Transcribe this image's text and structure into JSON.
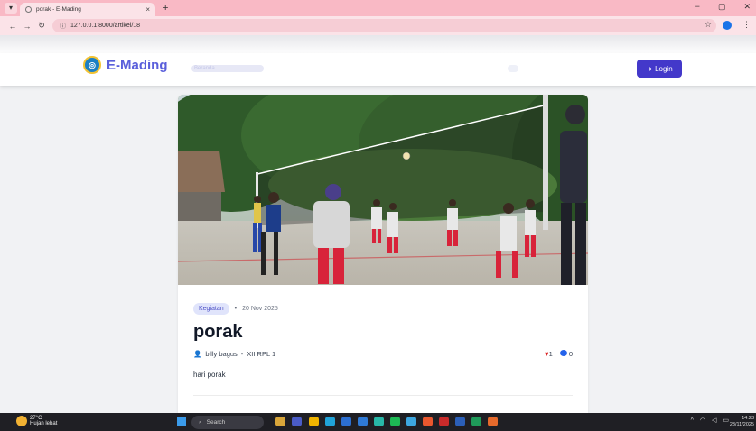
{
  "browser": {
    "tab_title": "porak - E-Mading",
    "tab_close": "×",
    "new_tab": "+",
    "url": "127.0.0.1:8000/artikel/18",
    "window_controls": [
      "−",
      "▢",
      "✕"
    ]
  },
  "site": {
    "brand": "E-Mading",
    "nav_home": "Beranda",
    "login_label": "Login"
  },
  "article": {
    "category": "Kegiatan",
    "date": "20 Nov 2025",
    "title": "porak",
    "author": "billy bagus",
    "class": "XII RPL 1",
    "likes": "1",
    "comments": "0",
    "content": "hari porak",
    "image_icon": "volleyball-photo"
  },
  "taskbar": {
    "temperature": "27°C",
    "weather": "Hujan lebat",
    "search_placeholder": "Search",
    "time": "14:23",
    "date": "23/11/2025"
  },
  "colors": {
    "tab_strip": "#f9b9c5",
    "brand": "#5a5fdb",
    "login_button": "#4338ca",
    "badge_bg": "#e0e4fb",
    "heart": "#dc2626",
    "comment": "#2563eb"
  }
}
